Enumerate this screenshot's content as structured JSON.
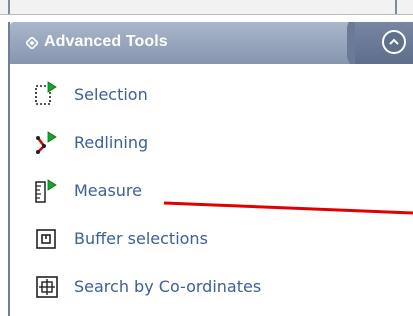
{
  "panel": {
    "title": "Advanced Tools"
  },
  "tools": [
    {
      "label": "Selection",
      "icon": "selection-icon"
    },
    {
      "label": "Redlining",
      "icon": "redlining-icon"
    },
    {
      "label": "Measure",
      "icon": "measure-icon"
    },
    {
      "label": "Buffer selections",
      "icon": "buffer-selections-icon"
    },
    {
      "label": "Search by Co-ordinates",
      "icon": "search-by-coordinates-icon"
    }
  ],
  "colors": {
    "header_bg": "#8796af",
    "header_tab": "#5e6e8b",
    "label_text": "#3b5f98",
    "arrow_green": "#1aa52a",
    "redline": "#e00000"
  }
}
